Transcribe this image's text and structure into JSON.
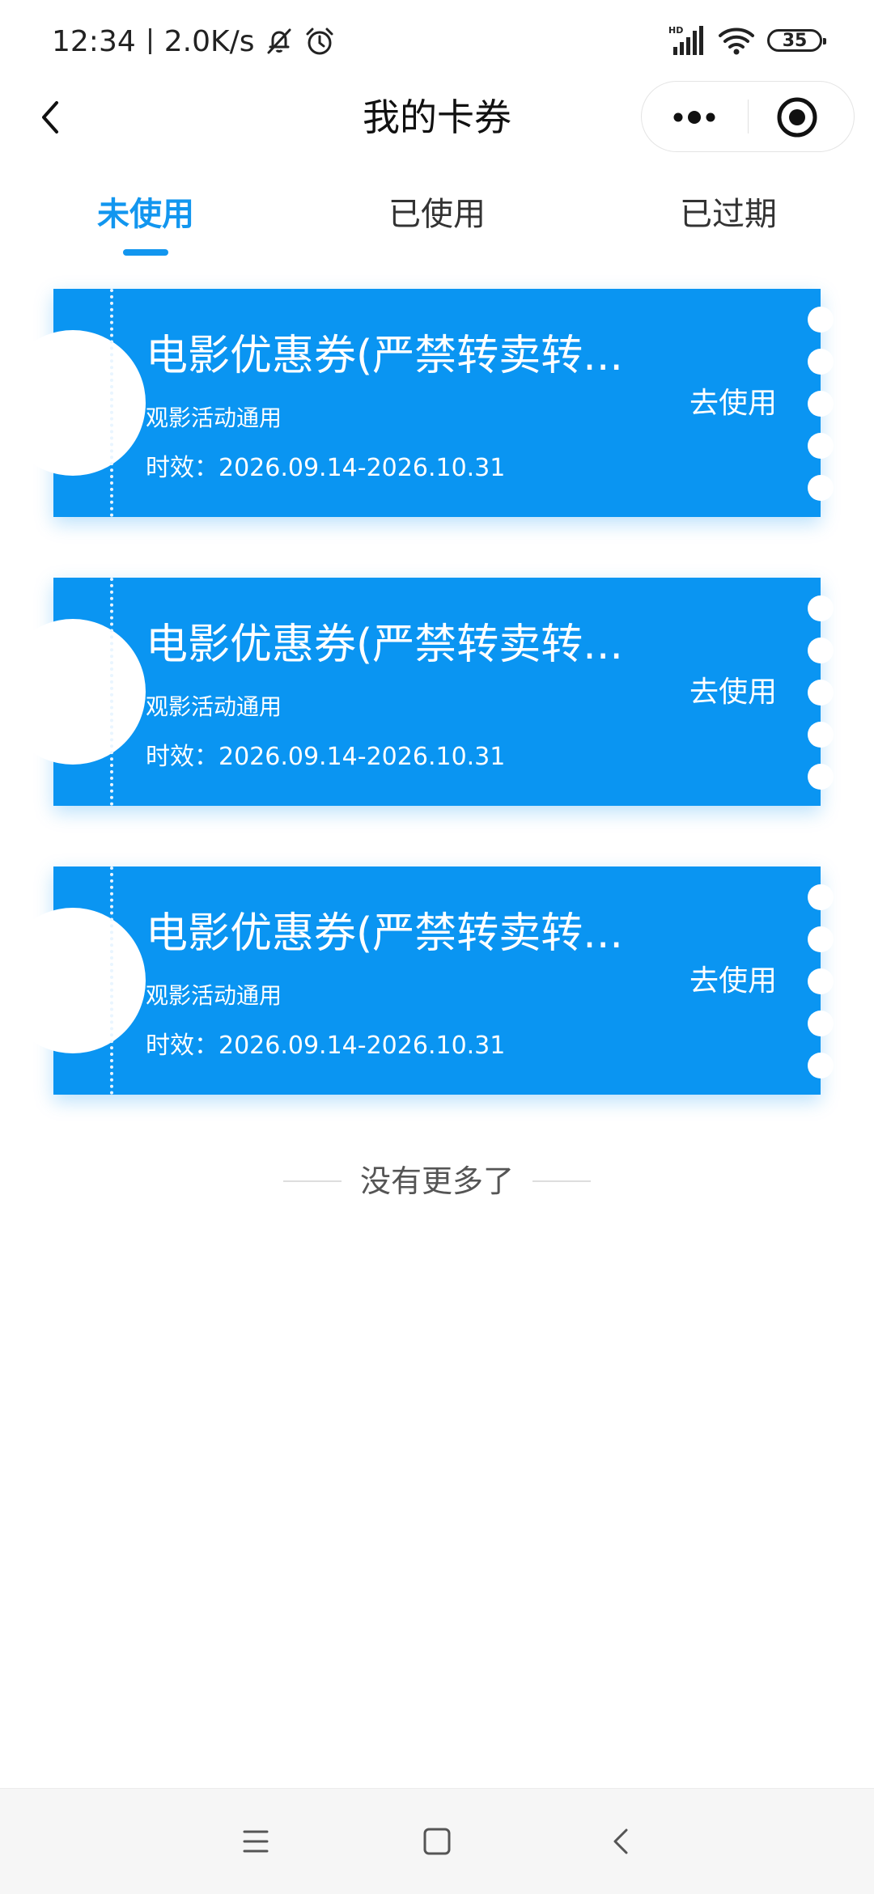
{
  "status_bar": {
    "time": "12:34",
    "network_speed": "2.0K/s",
    "icons": [
      "bell-muted-icon",
      "alarm-icon",
      "hd-signal-icon",
      "wifi-icon",
      "battery-icon"
    ],
    "battery_level": "35",
    "signal_label": "HD"
  },
  "nav": {
    "title": "我的卡券",
    "icons": [
      "chevron-left-icon",
      "more-dots-icon",
      "target-close-icon"
    ]
  },
  "tabs": [
    {
      "label": "未使用",
      "active": true
    },
    {
      "label": "已使用",
      "active": false
    },
    {
      "label": "已过期",
      "active": false
    }
  ],
  "coupons": [
    {
      "title": "电影优惠券(严禁转卖转...",
      "description": "观影活动通用",
      "validity": "时效：2026.09.14-2026.10.31",
      "action": "去使用"
    },
    {
      "title": "电影优惠券(严禁转卖转...",
      "description": "观影活动通用",
      "validity": "时效：2026.09.14-2026.10.31",
      "action": "去使用"
    },
    {
      "title": "电影优惠券(严禁转卖转...",
      "description": "观影活动通用",
      "validity": "时效：2026.09.14-2026.10.31",
      "action": "去使用"
    }
  ],
  "end_text": "没有更多了",
  "system_nav": {
    "icons": [
      "menu-icon",
      "home-square-icon",
      "back-icon"
    ]
  },
  "colors": {
    "accent": "#1296ef",
    "coupon_bg": "#0a95f2",
    "background": "#ffffff",
    "system_nav_bg": "#f6f6f6"
  }
}
